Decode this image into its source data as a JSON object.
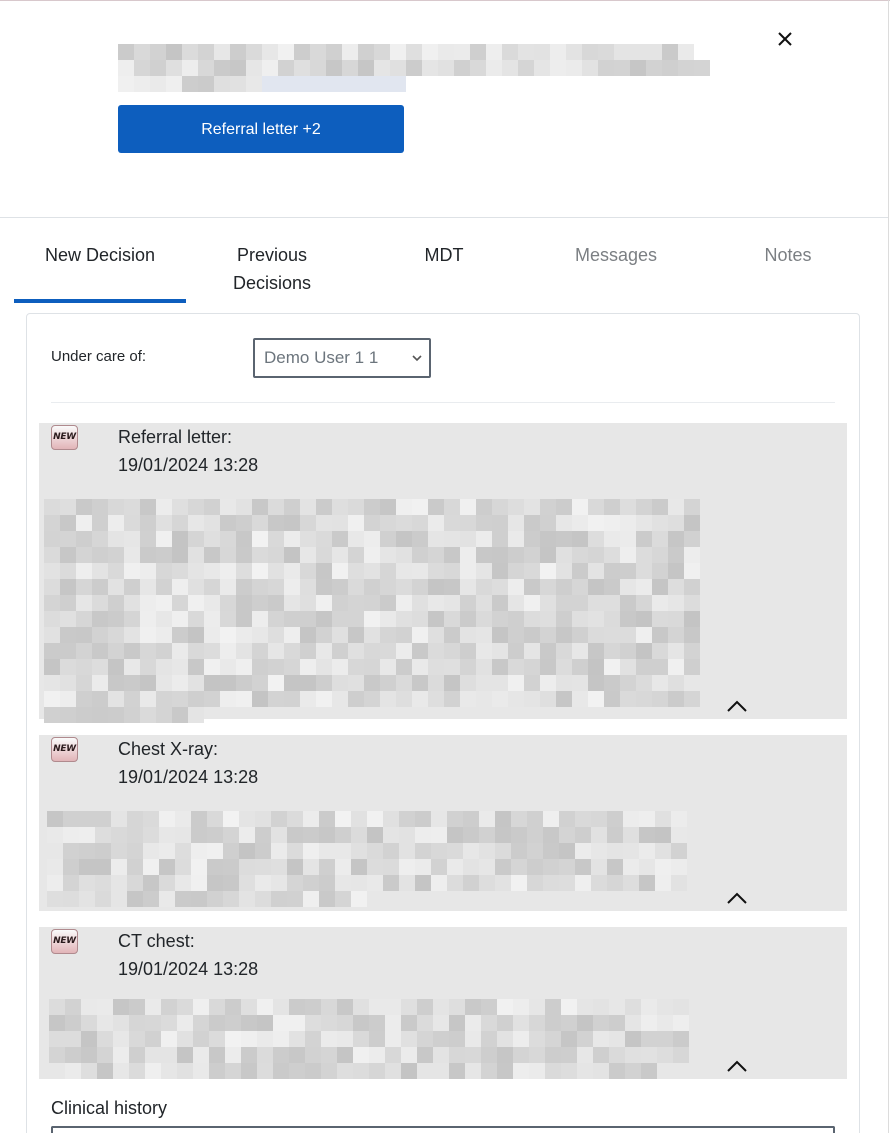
{
  "header": {
    "referral_button_label": "Referral letter +2"
  },
  "tabs": [
    {
      "label": "New Decision",
      "state": "active"
    },
    {
      "label": "Previous Decisions",
      "state": "normal"
    },
    {
      "label": "MDT",
      "state": "normal"
    },
    {
      "label": "Messages",
      "state": "muted"
    },
    {
      "label": "Notes",
      "state": "muted"
    }
  ],
  "care": {
    "label": "Under care of:",
    "selected": "Demo User 1 1"
  },
  "documents": [
    {
      "badge": "NEW",
      "title": "Referral letter:",
      "date": "19/01/2024 13:28"
    },
    {
      "badge": "NEW",
      "title": "Chest X-ray:",
      "date": "19/01/2024 13:28"
    },
    {
      "badge": "NEW",
      "title": "CT chest:",
      "date": "19/01/2024 13:28"
    }
  ],
  "clinical_history": {
    "label": "Clinical history"
  },
  "icons": {
    "close": "close-icon",
    "collapse": "chevron-up-icon",
    "select": "chevron-down-icon",
    "badge": "new-badge-icon"
  },
  "colors": {
    "primary": "#0d5ebe",
    "doc_background": "#e7e7e7",
    "muted_text": "#7b7f83"
  }
}
